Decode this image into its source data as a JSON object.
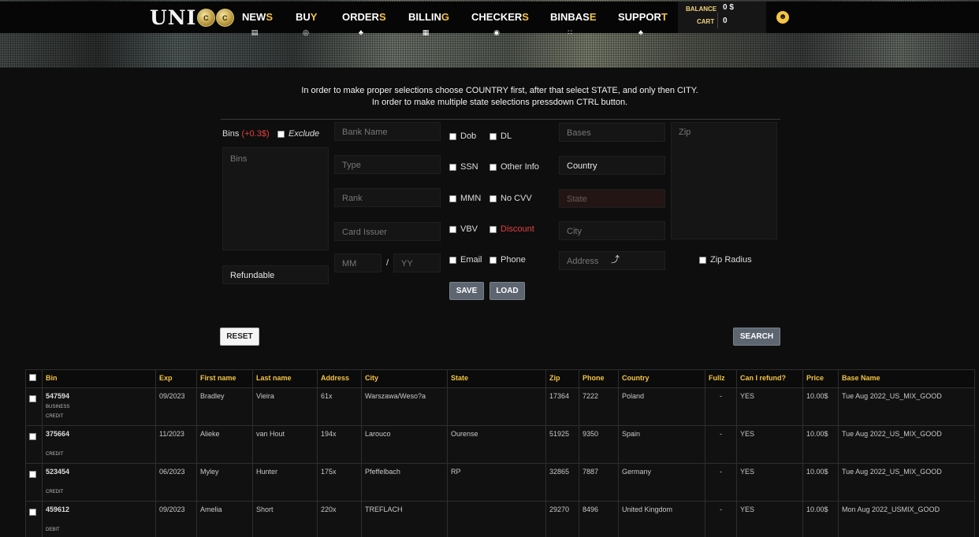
{
  "header": {
    "logo_text": "UNI",
    "logo_coin1": "C",
    "logo_coin2": "C",
    "nav": [
      {
        "main": "NEW",
        "last": "S"
      },
      {
        "main": "BU",
        "last": "Y"
      },
      {
        "main": "ORDER",
        "last": "S"
      },
      {
        "main": "BILLIN",
        "last": "G"
      },
      {
        "main": "CHECKER",
        "last": "S"
      },
      {
        "main": "BINBAS",
        "last": "E"
      },
      {
        "main": "SUPPOR",
        "last": "T"
      }
    ],
    "balance_label": "BALANCE",
    "balance_value": "0 $",
    "cart_label": "CART",
    "cart_value": "0"
  },
  "info": {
    "line1": "In order to make proper selections choose COUNTRY first, after that select STATE, and only then CITY.",
    "line2": "In order to make multiple state selections pressdown CTRL button."
  },
  "form": {
    "bins_label": "Bins",
    "bins_price": "(+0.3$)",
    "exclude_label": "Exclude",
    "bins_placeholder": "Bins",
    "refundable_value": "Refundable",
    "bank_name_placeholder": "Bank Name",
    "type_placeholder": "Type",
    "rank_placeholder": "Rank",
    "card_issuer_placeholder": "Card Issuer",
    "mm_placeholder": "MM",
    "slash": "/",
    "yy_placeholder": "YY",
    "checkboxes": {
      "dob": "Dob",
      "dl": "DL",
      "ssn": "SSN",
      "other_info": "Other Info",
      "mmn": "MMN",
      "no_cvv": "No CVV",
      "vbv": "VBV",
      "discount": "Discount",
      "email": "Email",
      "phone": "Phone"
    },
    "save_label": "SAVE",
    "load_label": "LOAD",
    "bases_placeholder": "Bases",
    "country_value": "Country",
    "state_placeholder": "State",
    "city_placeholder": "City",
    "address_placeholder": "Address",
    "zip_placeholder": "Zip",
    "zip_radius_label": "Zip Radius",
    "reset_label": "RESET",
    "search_label": "SEARCH"
  },
  "table": {
    "columns": [
      "Bin",
      "Exp",
      "First name",
      "Last name",
      "Address",
      "City",
      "State",
      "Zip",
      "Phone",
      "Country",
      "Fullz",
      "Can I refund?",
      "Price",
      "Base Name"
    ],
    "rows": [
      {
        "bin": "547594",
        "bin_sub1": "BUSINESS",
        "bin_sub2": "CREDIT",
        "exp": "09/2023",
        "first": "Bradley",
        "last": "Vieira",
        "address": "61x",
        "city": "Warszawa/Weso?a",
        "state": "",
        "zip": "17364",
        "phone": "7222",
        "country": "Poland",
        "fullz": "-",
        "refund": "YES",
        "price": "10.00$",
        "base": "Tue Aug 2022_US_MIX_GOOD"
      },
      {
        "bin": "375664",
        "bin_sub1": "",
        "bin_sub2": "CREDIT",
        "exp": "11/2023",
        "first": "Alieke",
        "last": "van Hout",
        "address": "194x",
        "city": "Larouco",
        "state": "Ourense",
        "zip": "51925",
        "phone": "9350",
        "country": "Spain",
        "fullz": "-",
        "refund": "YES",
        "price": "10.00$",
        "base": "Tue Aug 2022_US_MIX_GOOD"
      },
      {
        "bin": "523454",
        "bin_sub1": "",
        "bin_sub2": "CREDIT",
        "exp": "06/2023",
        "first": "Myley",
        "last": "Hunter",
        "address": "175x",
        "city": "Pfeffelbach",
        "state": "RP",
        "zip": "32865",
        "phone": "7887",
        "country": "Germany",
        "fullz": "-",
        "refund": "YES",
        "price": "10.00$",
        "base": "Tue Aug 2022_US_MIX_GOOD"
      },
      {
        "bin": "459612",
        "bin_sub1": "",
        "bin_sub2": "DEBIT",
        "exp": "09/2023",
        "first": "Amelia",
        "last": "Short",
        "address": "220x",
        "city": "TREFLACH",
        "state": "",
        "zip": "29270",
        "phone": "8496",
        "country": "United Kingdom",
        "fullz": "-",
        "refund": "YES",
        "price": "10.00$",
        "base": "Mon Aug 2022_USMIX_GOOD"
      }
    ]
  },
  "colors": {
    "accent": "#f5c542",
    "danger": "#e34040",
    "button_gray": "#5d6670"
  }
}
